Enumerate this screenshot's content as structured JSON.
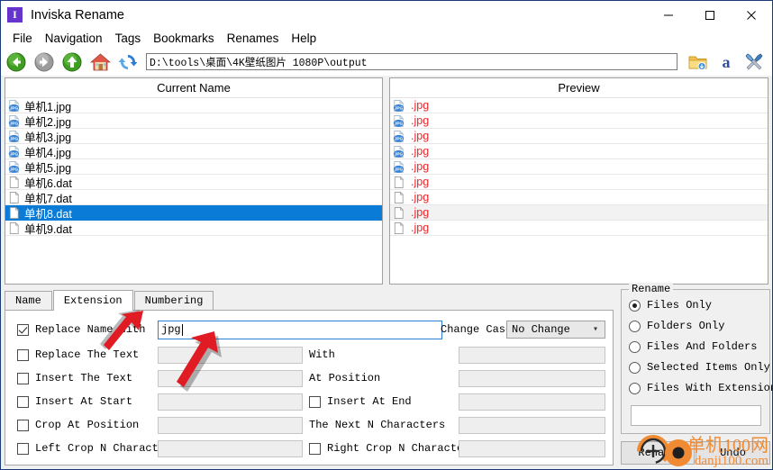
{
  "window": {
    "title": "Inviska Rename",
    "icon_letter": "I",
    "minimize": "—",
    "maximize": "□",
    "close": "✕"
  },
  "menubar": {
    "items": [
      "File",
      "Navigation",
      "Tags",
      "Bookmarks",
      "Renames",
      "Help"
    ]
  },
  "toolbar": {
    "back_icon": "back-arrow-icon",
    "forward_icon": "forward-arrow-icon",
    "up_icon": "up-arrow-icon",
    "home_icon": "home-icon",
    "refresh_icon": "refresh-icon",
    "address": "D:\\tools\\桌面\\4K壁纸图片 1080P\\output",
    "open_folder_icon": "open-folder-icon",
    "font_icon": "font-a-icon",
    "settings_icon": "tools-settings-icon"
  },
  "lists": {
    "current_header": "Current Name",
    "preview_header": "Preview",
    "rows": [
      {
        "name": "单机1.jpg",
        "preview": ".jpg",
        "type": "jpg",
        "state": "normal"
      },
      {
        "name": "单机2.jpg",
        "preview": ".jpg",
        "type": "jpg",
        "state": "normal"
      },
      {
        "name": "单机3.jpg",
        "preview": ".jpg",
        "type": "jpg",
        "state": "normal"
      },
      {
        "name": "单机4.jpg",
        "preview": ".jpg",
        "type": "jpg",
        "state": "normal"
      },
      {
        "name": "单机5.jpg",
        "preview": ".jpg",
        "type": "jpg",
        "state": "normal"
      },
      {
        "name": "单机6.dat",
        "preview": ".jpg",
        "type": "dat",
        "state": "normal"
      },
      {
        "name": "单机7.dat",
        "preview": ".jpg",
        "type": "dat",
        "state": "normal"
      },
      {
        "name": "单机8.dat",
        "preview": ".jpg",
        "type": "dat",
        "state": "selected"
      },
      {
        "name": "单机9.dat",
        "preview": ".jpg",
        "type": "dat",
        "state": "normal"
      }
    ]
  },
  "tabs": [
    {
      "label": "Name",
      "active": false
    },
    {
      "label": "Extension",
      "active": true
    },
    {
      "label": "Numbering",
      "active": false
    }
  ],
  "options": {
    "rows": [
      {
        "checkbox_label": "Replace Name With",
        "checked": true,
        "input_value": "jpg",
        "input_active": true,
        "trailing_label": "Change Case",
        "combo_value": "No Change"
      },
      {
        "checkbox_label": "Replace The Text",
        "checked": false,
        "input_value": "",
        "input_active": false,
        "trailing_label": "With",
        "second_input_value": ""
      },
      {
        "checkbox_label": "Insert The Text",
        "checked": false,
        "input_value": "",
        "input_active": false,
        "trailing_label": "At Position",
        "second_input_value": ""
      },
      {
        "checkbox_label": "Insert At Start",
        "checked": false,
        "input_value": "",
        "input_active": false,
        "trailing_checkbox_label": "Insert At End",
        "trailing_checked": false,
        "second_input_value": ""
      },
      {
        "checkbox_label": "Crop At Position",
        "checked": false,
        "input_value": "",
        "input_active": false,
        "trailing_label": "The Next N Characters",
        "second_input_value": ""
      },
      {
        "checkbox_label": "Left Crop N Characters",
        "checked": false,
        "input_value": "",
        "input_active": false,
        "trailing_checkbox_label": "Right Crop N Characters",
        "trailing_checked": false,
        "second_input_value": ""
      }
    ]
  },
  "rename_group": {
    "title": "Rename",
    "radios": [
      {
        "label": "Files Only",
        "selected": true
      },
      {
        "label": "Folders Only",
        "selected": false
      },
      {
        "label": "Files And Folders",
        "selected": false
      },
      {
        "label": "Selected Items Only",
        "selected": false
      },
      {
        "label": "Files With Extensions:",
        "selected": false
      }
    ],
    "extensions_value": ""
  },
  "actions": {
    "rename_label": "Rename",
    "undo_label": "Undo"
  },
  "watermark": {
    "cn": "单机100网",
    "en": "danji100.com",
    "color": "#f08a33"
  },
  "colors": {
    "selection_blue": "#0a7bd6",
    "preview_red": "#e8262a",
    "accent_purple": "#6633cc",
    "annotation_red": "#e01b24"
  }
}
